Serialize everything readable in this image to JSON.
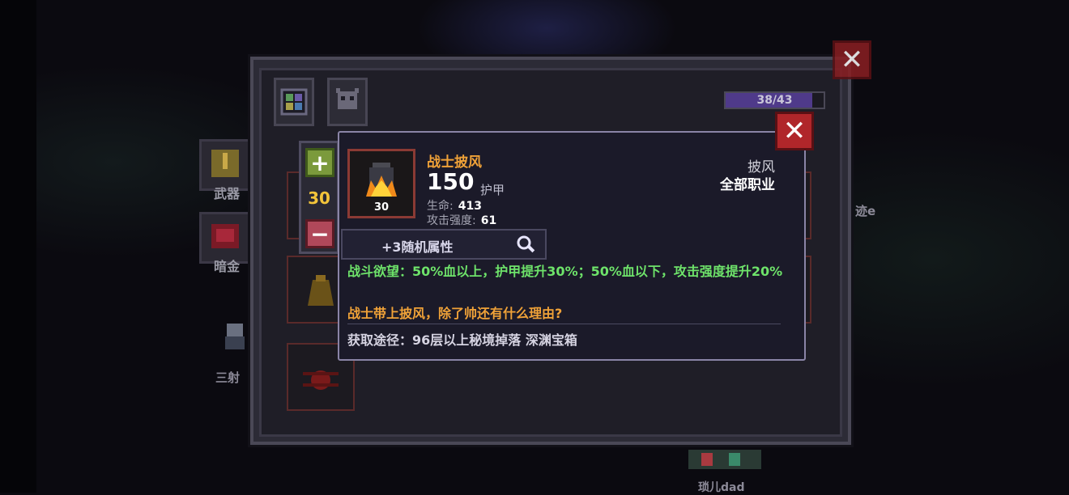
{
  "side_menu": {
    "weapon_label": "武器",
    "dark_gold_label": "暗金",
    "triple_shot_label": "三射"
  },
  "background": {
    "right_name": "迹e",
    "bottom_name": "琐儿dad"
  },
  "panel": {
    "progress_text": "38/43",
    "progress_fraction": 0.884
  },
  "stepper": {
    "plus": "+",
    "minus": "−",
    "value": "30"
  },
  "tooltip": {
    "item_level": "30",
    "item_name": "战士披风",
    "armor_value": "150",
    "armor_label": "护甲",
    "stats": [
      {
        "label": "生命:",
        "value": "413"
      },
      {
        "label": "攻击强度:",
        "value": "61"
      }
    ],
    "item_type": "披风",
    "item_class": "全部职业",
    "random_attr": "+3随机属性",
    "effect": "战斗欲望：50%血以上，护甲提升30%；50%血以下，攻击强度提升20%",
    "flavor": "战士带上披风，除了帅还有什么理由?",
    "source": "获取途径：96层以上秘境掉落 深渊宝箱"
  },
  "colors": {
    "item_name": "#f0a238",
    "effect_text": "#6ee36a",
    "close_button": "#b0262a",
    "stepper_value": "#f3c43a"
  }
}
